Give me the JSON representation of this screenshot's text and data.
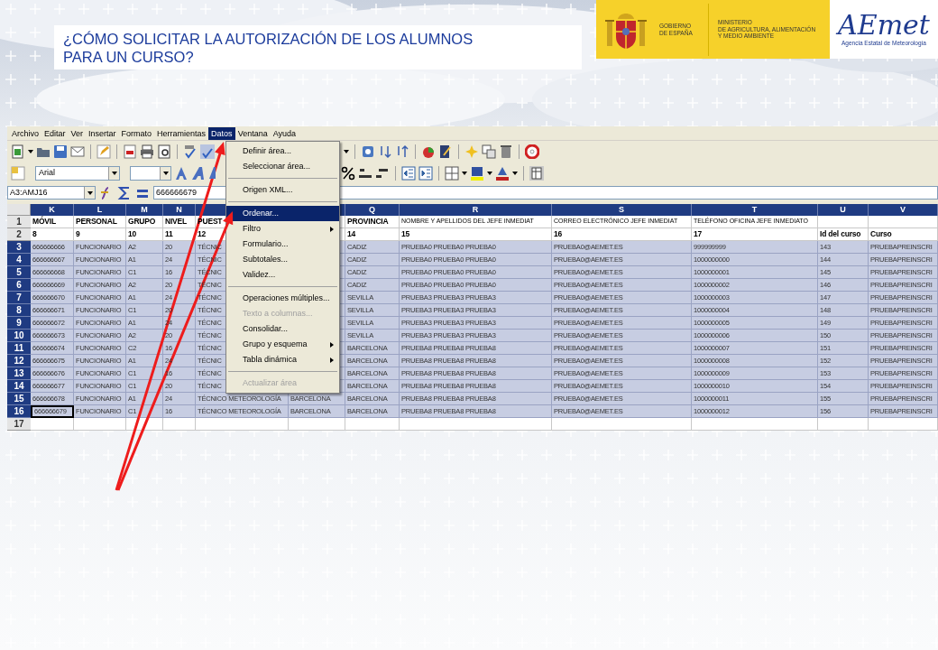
{
  "slide": {
    "title_lines": [
      "¿CÓMO SOLICITAR LA AUTORIZACIÓN DE LOS ALUMNOS",
      "PARA UN CURSO?"
    ]
  },
  "logos": {
    "gobierno": [
      "GOBIERNO",
      "DE ESPAÑA"
    ],
    "ministerio": [
      "MINISTERIO",
      "DE AGRICULTURA, ALIMENTACIÓN",
      "Y MEDIO AMBIENTE"
    ],
    "aemet": {
      "wordmark": "AEmet",
      "subtitle": "Agencia Estatal de Meteorología"
    }
  },
  "menu_bar": [
    {
      "label": "Archivo",
      "selected": false
    },
    {
      "label": "Editar",
      "selected": false
    },
    {
      "label": "Ver",
      "selected": false
    },
    {
      "label": "Insertar",
      "selected": false
    },
    {
      "label": "Formato",
      "selected": false
    },
    {
      "label": "Herramientas",
      "selected": false
    },
    {
      "label": "Datos",
      "selected": true
    },
    {
      "label": "Ventana",
      "selected": false
    },
    {
      "label": "Ayuda",
      "selected": false
    }
  ],
  "font_name": "Arial",
  "name_box": "A3:AMJ16",
  "formula": "666666679",
  "columns": [
    {
      "letter": "K"
    },
    {
      "letter": "L"
    },
    {
      "letter": "M"
    },
    {
      "letter": "N"
    },
    {},
    {},
    {
      "letter": "Q"
    },
    {
      "letter": "R"
    },
    {
      "letter": "S"
    },
    {
      "letter": "T"
    },
    {
      "letter": "U"
    },
    {
      "letter": "V"
    }
  ],
  "rows": [
    {
      "number": "1",
      "kind": "header",
      "selected": false,
      "cursor": false,
      "cells": [
        "MÓVIL",
        "PERSONAL",
        "GRUPO",
        "NIVEL",
        "PUEST",
        null,
        "PROVINCIA",
        "NOMBRE Y APELLIDOS DEL JEFE INMEDIAT",
        "CORREO ELECTRÓNICO JEFE INMEDIAT",
        "TELÉFONO OFICINA JEFE INMEDIATO",
        null,
        null
      ]
    },
    {
      "number": "2",
      "kind": "header",
      "selected": false,
      "cursor": false,
      "cells": [
        "8",
        "9",
        "10",
        "11",
        "12",
        null,
        "14",
        "15",
        "16",
        "17",
        "Id del curso",
        "Curso"
      ]
    },
    {
      "number": "3",
      "kind": "data",
      "selected": true,
      "cursor": false,
      "cells": [
        "666666666",
        "FUNCIONARIO",
        "A2",
        "20",
        "TÉCNIC",
        null,
        "CADIZ",
        "PRUEBA0 PRUEBA0 PRUEBA0",
        "PRUEBA0@AEMET.ES",
        "999999999",
        "143",
        "PRUEBAPREINSCRI"
      ]
    },
    {
      "number": "4",
      "kind": "data",
      "selected": true,
      "cursor": false,
      "cells": [
        "666666667",
        "FUNCIONARIO",
        "A1",
        "24",
        "TÉCNIC",
        null,
        "CADIZ",
        "PRUEBA0 PRUEBA0 PRUEBA0",
        "PRUEBA0@AEMET.ES",
        "1000000000",
        "144",
        "PRUEBAPREINSCRI"
      ]
    },
    {
      "number": "5",
      "kind": "data",
      "selected": true,
      "cursor": false,
      "cells": [
        "666666668",
        "FUNCIONARIO",
        "C1",
        "16",
        "TÉCNIC",
        null,
        "CADIZ",
        "PRUEBA0 PRUEBA0 PRUEBA0",
        "PRUEBA0@AEMET.ES",
        "1000000001",
        "145",
        "PRUEBAPREINSCRI"
      ]
    },
    {
      "number": "6",
      "kind": "data",
      "selected": true,
      "cursor": false,
      "cells": [
        "666666669",
        "FUNCIONARIO",
        "A2",
        "20",
        "TÉCNIC",
        null,
        "CADIZ",
        "PRUEBA0 PRUEBA0 PRUEBA0",
        "PRUEBA0@AEMET.ES",
        "1000000002",
        "146",
        "PRUEBAPREINSCRI"
      ]
    },
    {
      "number": "7",
      "kind": "data",
      "selected": true,
      "cursor": false,
      "cells": [
        "666666670",
        "FUNCIONARIO",
        "A1",
        "24",
        "TÉCNIC",
        null,
        "SEVILLA",
        "PRUEBA3 PRUEBA3 PRUEBA3",
        "PRUEBA0@AEMET.ES",
        "1000000003",
        "147",
        "PRUEBAPREINSCRI"
      ]
    },
    {
      "number": "8",
      "kind": "data",
      "selected": true,
      "cursor": false,
      "cells": [
        "666666671",
        "FUNCIONARIO",
        "C1",
        "20",
        "TÉCNIC",
        null,
        "SEVILLA",
        "PRUEBA3 PRUEBA3 PRUEBA3",
        "PRUEBA0@AEMET.ES",
        "1000000004",
        "148",
        "PRUEBAPREINSCRI"
      ]
    },
    {
      "number": "9",
      "kind": "data",
      "selected": true,
      "cursor": false,
      "cells": [
        "666666672",
        "FUNCIONARIO",
        "A1",
        "24",
        "TÉCNIC",
        null,
        "SEVILLA",
        "PRUEBA3 PRUEBA3 PRUEBA3",
        "PRUEBA0@AEMET.ES",
        "1000000005",
        "149",
        "PRUEBAPREINSCRI"
      ]
    },
    {
      "number": "10",
      "kind": "data",
      "selected": true,
      "cursor": false,
      "cells": [
        "666666673",
        "FUNCIONARIO",
        "A2",
        "20",
        "TÉCNIC",
        null,
        "SEVILLA",
        "PRUEBA3 PRUEBA3 PRUEBA3",
        "PRUEBA0@AEMET.ES",
        "1000000006",
        "150",
        "PRUEBAPREINSCRI"
      ]
    },
    {
      "number": "11",
      "kind": "data",
      "selected": true,
      "cursor": false,
      "cells": [
        "666666674",
        "FUNCIONARIO",
        "C2",
        "16",
        "TÉCNIC",
        null,
        "BARCELONA",
        "PRUEBA8 PRUEBA8 PRUEBA8",
        "PRUEBA0@AEMET.ES",
        "1000000007",
        "151",
        "PRUEBAPREINSCRI"
      ]
    },
    {
      "number": "12",
      "kind": "data",
      "selected": true,
      "cursor": false,
      "cells": [
        "666666675",
        "FUNCIONARIO",
        "A1",
        "24",
        "TÉCNIC",
        null,
        "BARCELONA",
        "PRUEBA8 PRUEBA8 PRUEBA8",
        "PRUEBA0@AEMET.ES",
        "1000000008",
        "152",
        "PRUEBAPREINSCRI"
      ]
    },
    {
      "number": "13",
      "kind": "data",
      "selected": true,
      "cursor": false,
      "cells": [
        "666666676",
        "FUNCIONARIO",
        "C1",
        "16",
        "TÉCNIC",
        null,
        "BARCELONA",
        "PRUEBA8 PRUEBA8 PRUEBA8",
        "PRUEBA0@AEMET.ES",
        "1000000009",
        "153",
        "PRUEBAPREINSCRI"
      ]
    },
    {
      "number": "14",
      "kind": "data",
      "selected": true,
      "cursor": false,
      "cells": [
        "666666677",
        "FUNCIONARIO",
        "C1",
        "20",
        "TÉCNIC",
        null,
        "BARCELONA",
        "PRUEBA8 PRUEBA8 PRUEBA8",
        "PRUEBA0@AEMET.ES",
        "1000000010",
        "154",
        "PRUEBAPREINSCRI"
      ]
    },
    {
      "number": "15",
      "kind": "data",
      "selected": true,
      "cursor": false,
      "cells": [
        "666666678",
        "FUNCIONARIO",
        "A1",
        "24",
        "TÉCNICO METEOROLOGÍA",
        "BARCELONA",
        "BARCELONA",
        "PRUEBA8 PRUEBA8 PRUEBA8",
        "PRUEBA0@AEMET.ES",
        "1000000011",
        "155",
        "PRUEBAPREINSCRI"
      ]
    },
    {
      "number": "16",
      "kind": "data",
      "selected": true,
      "cursor": true,
      "cells": [
        "666666679",
        "FUNCIONARIO",
        "C1",
        "16",
        "TÉCNICO METEOROLOGÍA",
        "BARCELONA",
        "BARCELONA",
        "PRUEBA8 PRUEBA8 PRUEBA8",
        "PRUEBA0@AEMET.ES",
        "1000000012",
        "156",
        "PRUEBAPREINSCRI"
      ]
    },
    {
      "number": "17",
      "kind": "empty",
      "selected": false,
      "cursor": false,
      "cells": [
        null,
        null,
        null,
        null,
        null,
        null,
        null,
        null,
        null,
        null,
        null,
        null
      ]
    }
  ],
  "dropdown": [
    {
      "kind": "item",
      "label": "Definir área...",
      "selected": false,
      "disabled": false,
      "submenu": false
    },
    {
      "kind": "item",
      "label": "Seleccionar área...",
      "selected": false,
      "disabled": false,
      "submenu": false
    },
    {
      "kind": "separator"
    },
    {
      "kind": "item",
      "label": "Origen XML...",
      "selected": false,
      "disabled": false,
      "submenu": false
    },
    {
      "kind": "separator"
    },
    {
      "kind": "item",
      "label": "Ordenar...",
      "selected": true,
      "disabled": false,
      "submenu": false
    },
    {
      "kind": "item",
      "label": "Filtro",
      "selected": false,
      "disabled": false,
      "submenu": true
    },
    {
      "kind": "item",
      "label": "Formulario...",
      "selected": false,
      "disabled": false,
      "submenu": false
    },
    {
      "kind": "item",
      "label": "Subtotales...",
      "selected": false,
      "disabled": false,
      "submenu": false
    },
    {
      "kind": "item",
      "label": "Validez...",
      "selected": false,
      "disabled": false,
      "submenu": false
    },
    {
      "kind": "separator"
    },
    {
      "kind": "item",
      "label": "Operaciones múltiples...",
      "selected": false,
      "disabled": false,
      "submenu": false
    },
    {
      "kind": "item",
      "label": "Texto a columnas...",
      "selected": false,
      "disabled": true,
      "submenu": false
    },
    {
      "kind": "item",
      "label": "Consolidar...",
      "selected": false,
      "disabled": false,
      "submenu": false
    },
    {
      "kind": "item",
      "label": "Grupo y esquema",
      "selected": false,
      "disabled": false,
      "submenu": true
    },
    {
      "kind": "item",
      "label": "Tabla dinámica",
      "selected": false,
      "disabled": false,
      "submenu": true
    },
    {
      "kind": "separator"
    },
    {
      "kind": "item",
      "label": "Actualizar área",
      "selected": false,
      "disabled": true,
      "submenu": false
    }
  ]
}
